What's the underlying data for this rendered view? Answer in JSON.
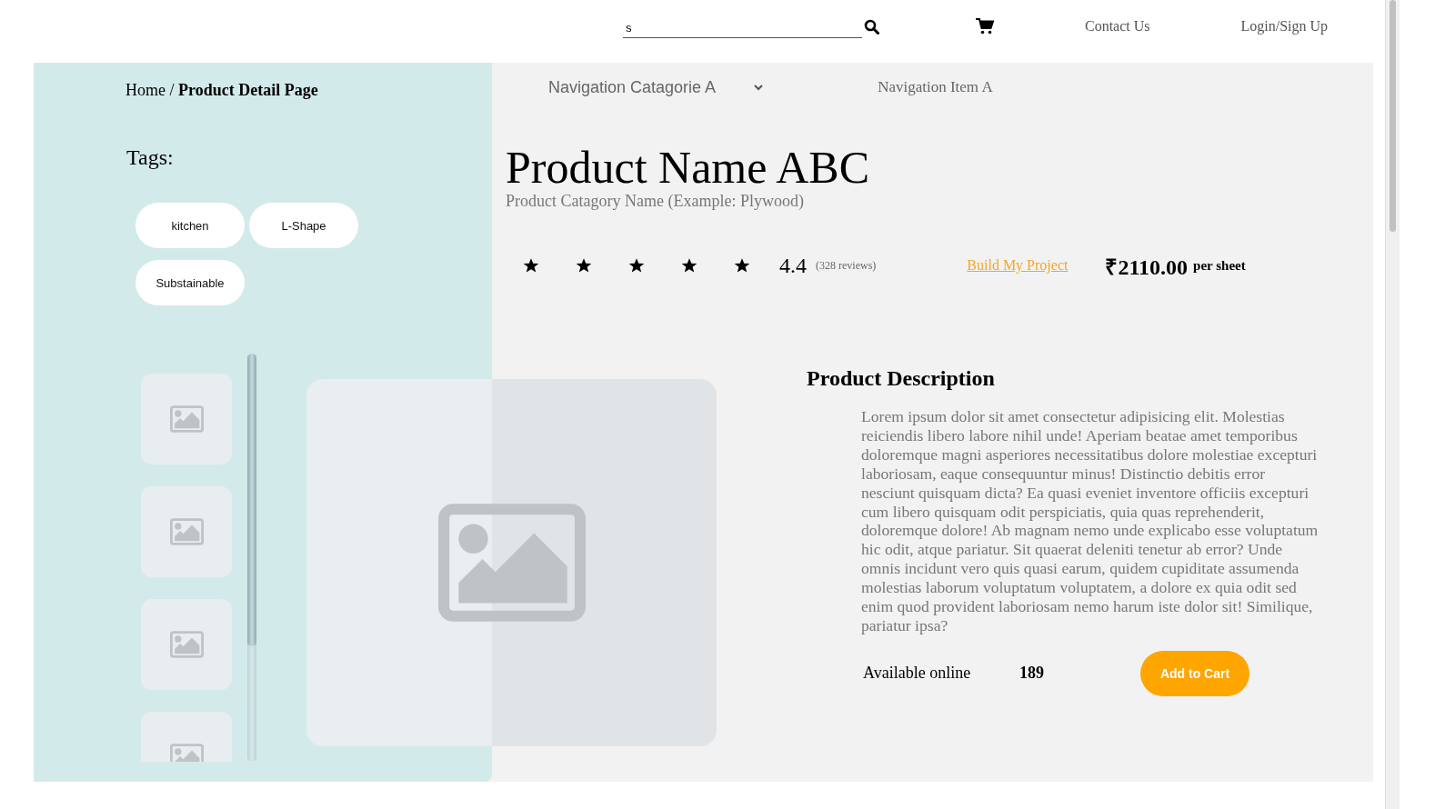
{
  "header": {
    "search": {
      "value": "s"
    },
    "links": [
      "Contact Us",
      "Login/Sign Up"
    ]
  },
  "breadcrumb": "Home / **Product Detail Page**",
  "tags": {
    "title": "Tags:",
    "items": [
      "kitchen",
      "L-Shape",
      "Substainable"
    ]
  },
  "nav": [
    {
      "label": "Navigation Catagorie A",
      "kind": "dropdown"
    },
    {
      "label": "Navigation Item A",
      "kind": "link"
    }
  ],
  "product": {
    "name": "Product Name ABC",
    "category": "Product Catagory Name (Example: Plywood)",
    "stars": 5,
    "rating": "4.4",
    "reviews": "(328 reviews)",
    "project_link": "Build My Project",
    "price": "₹2110.00",
    "unit": "per sheet"
  },
  "description": {
    "title": "Product Description",
    "text": "Lorem ipsum dolor sit amet consectetur adipisicing elit. Molestias reiciendis libero labore nihil unde! Aperiam beatae amet temporibus doloremque magni asperiores necessitatibus dolore molestiae excepturi laboriosam, eaque consequuntur minus! Distinctio debitis error nesciunt quisquam dicta? Ea quasi eveniet inventore officiis excepturi cum libero quisquam odit perspiciatis, quia quas reprehenderit, doloremque dolore! Ab magnam nemo unde explicabo esse voluptatum hic odit, atque pariatur. Sit quaerat deleniti tenetur ab error? Unde omnis incidunt vero quis quasi earum, quidem cupiditate assumenda molestias laborum voluptatum voluptatem, a dolore ex quia odit sed enim quod provident laboriosam nemo harum iste dolor sit! Similique, pariatur ipsa?",
    "availability_label": "Available online",
    "stock": "189",
    "button": "Add to Cart"
  }
}
